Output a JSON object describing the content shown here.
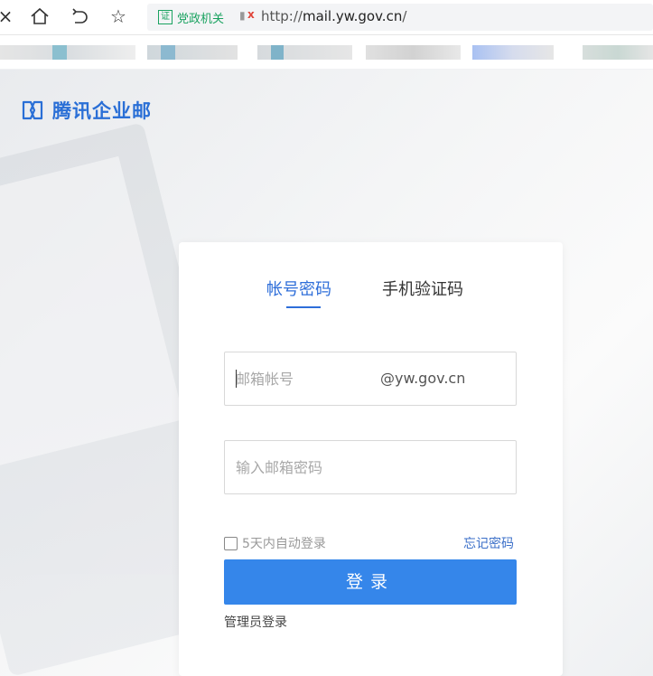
{
  "browser": {
    "cert_badge": "证",
    "cert_label": "党政机关",
    "url_prefix": "http://",
    "url_host": "mail.yw.gov.cn",
    "url_suffix": "/",
    "icons": [
      "close-icon",
      "home-icon",
      "undo-icon",
      "star-icon",
      "lock-warning-icon"
    ]
  },
  "header": {
    "logo_text": "腾讯企业邮",
    "logo_color": "#2a6fd6"
  },
  "login": {
    "tabs": [
      {
        "label": "帐号密码",
        "active": true
      },
      {
        "label": "手机验证码",
        "active": false
      }
    ],
    "account_placeholder": "邮箱帐号",
    "account_domain": "@yw.gov.cn",
    "password_placeholder": "输入邮箱密码",
    "remember_label": "5天内自动登录",
    "remember_checked": false,
    "forgot_label": "忘记密码",
    "submit_label": "登录",
    "admin_link": "管理员登录",
    "accent_color": "#3586ea"
  }
}
